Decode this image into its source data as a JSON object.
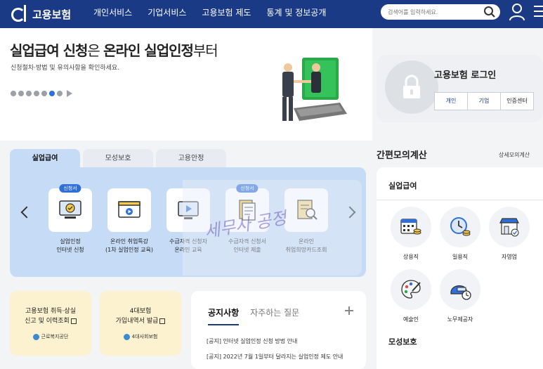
{
  "header": {
    "logo_text": "고용보험",
    "nav": [
      "개인서비스",
      "기업서비스",
      "고용보험 제도",
      "통계 및 정보공개"
    ],
    "search_placeholder": "검색어를 입력하세요."
  },
  "hero": {
    "title_part1": "실업급여 신청",
    "title_part2": "은 ",
    "title_part3": "온라인 실업인정",
    "title_part4": "부터",
    "subtitle": "신청절차·방법 및 유의사항을 확인하세요."
  },
  "login": {
    "title": "고용보험 로그인",
    "tabs": [
      "개인",
      "기업",
      "인증센터"
    ]
  },
  "services": {
    "tabs": [
      "실업급여",
      "모성보호",
      "고용안정"
    ],
    "items": [
      {
        "badge": "신청서",
        "label": "실업인정\n인터넷 신청"
      },
      {
        "badge": "",
        "label": "온라인 취업특강\n(1차 실업인정 교육)"
      },
      {
        "badge": "",
        "label": "수급자격 신청자\n온라인 교육"
      },
      {
        "badge": "신청서",
        "label": "수급자격 신청서\n인터넷 제출"
      },
      {
        "badge": "",
        "label": "온라인\n취업희망카드조회"
      }
    ]
  },
  "watermark": "세무사 공정",
  "cards": [
    {
      "text": "고용보험 취득·상실\n신고 및 이력조회",
      "brand": "근로복지공단"
    },
    {
      "text": "4대보험\n가입내역서 발급",
      "brand": "4대사회보험"
    }
  ],
  "notice": {
    "tabs": [
      "공지사항",
      "자주하는 질문"
    ],
    "items": [
      "[공지] 인터넷 실업인정 신청 방법 안내",
      "[공지] 2022년 7월 1일부터 달라지는 실업인정 제도 안내"
    ]
  },
  "calc": {
    "title": "간편모의계산",
    "more": "상세모의계산",
    "section1": "실업급여",
    "items": [
      "상용직",
      "일용직",
      "자영업",
      "예술인",
      "노무제공자"
    ],
    "section2": "모성보호"
  },
  "colors": {
    "header_bg": "#1b3a86",
    "accent": "#2f6fdb",
    "panel_bg": "#c6dbf5",
    "card_bg": "#fdf2d0"
  }
}
